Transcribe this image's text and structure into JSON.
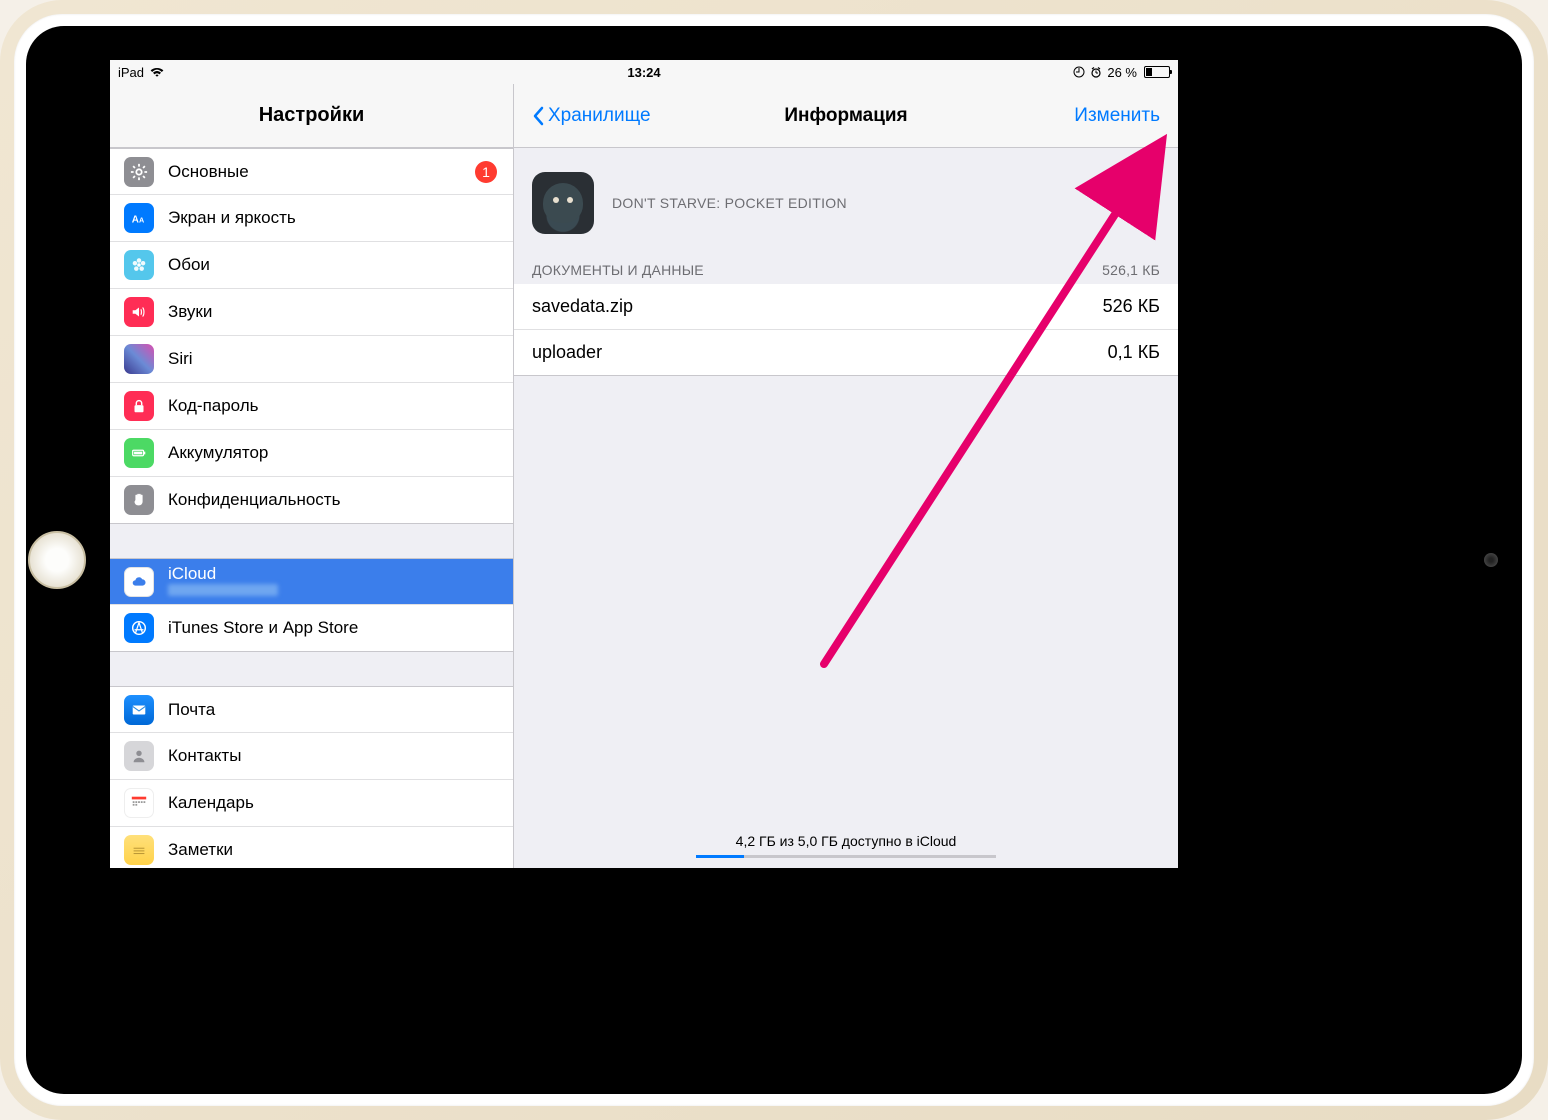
{
  "status": {
    "device": "iPad",
    "time": "13:24",
    "battery_percent": "26 %"
  },
  "sidebar": {
    "title": "Настройки",
    "groups": [
      {
        "items": [
          {
            "label": "Основные",
            "icon": "gear",
            "badge": "1"
          },
          {
            "label": "Экран и яркость",
            "icon": "display"
          },
          {
            "label": "Обои",
            "icon": "wallpaper"
          },
          {
            "label": "Звуки",
            "icon": "sounds"
          },
          {
            "label": "Siri",
            "icon": "siri"
          },
          {
            "label": "Код-пароль",
            "icon": "passcode"
          },
          {
            "label": "Аккумулятор",
            "icon": "battery"
          },
          {
            "label": "Конфиденциальность",
            "icon": "privacy"
          }
        ]
      },
      {
        "items": [
          {
            "label": "iCloud",
            "icon": "icloud",
            "selected": true
          },
          {
            "label": "iTunes Store и App Store",
            "icon": "appstore"
          }
        ]
      },
      {
        "items": [
          {
            "label": "Почта",
            "icon": "mail"
          },
          {
            "label": "Контакты",
            "icon": "contacts"
          },
          {
            "label": "Календарь",
            "icon": "calendar"
          },
          {
            "label": "Заметки",
            "icon": "notes"
          }
        ]
      }
    ]
  },
  "detail": {
    "back": "Хранилище",
    "title": "Информация",
    "edit": "Изменить",
    "app": {
      "name": "DON'T STARVE: POCKET EDITION"
    },
    "docs_header": "ДОКУМЕНТЫ И ДАННЫЕ",
    "docs_total": "526,1 КБ",
    "files": [
      {
        "name": "savedata.zip",
        "size": "526 КБ"
      },
      {
        "name": "uploader",
        "size": "0,1 КБ"
      }
    ],
    "storage_text": "4,2 ГБ из 5,0 ГБ доступно в iCloud"
  }
}
